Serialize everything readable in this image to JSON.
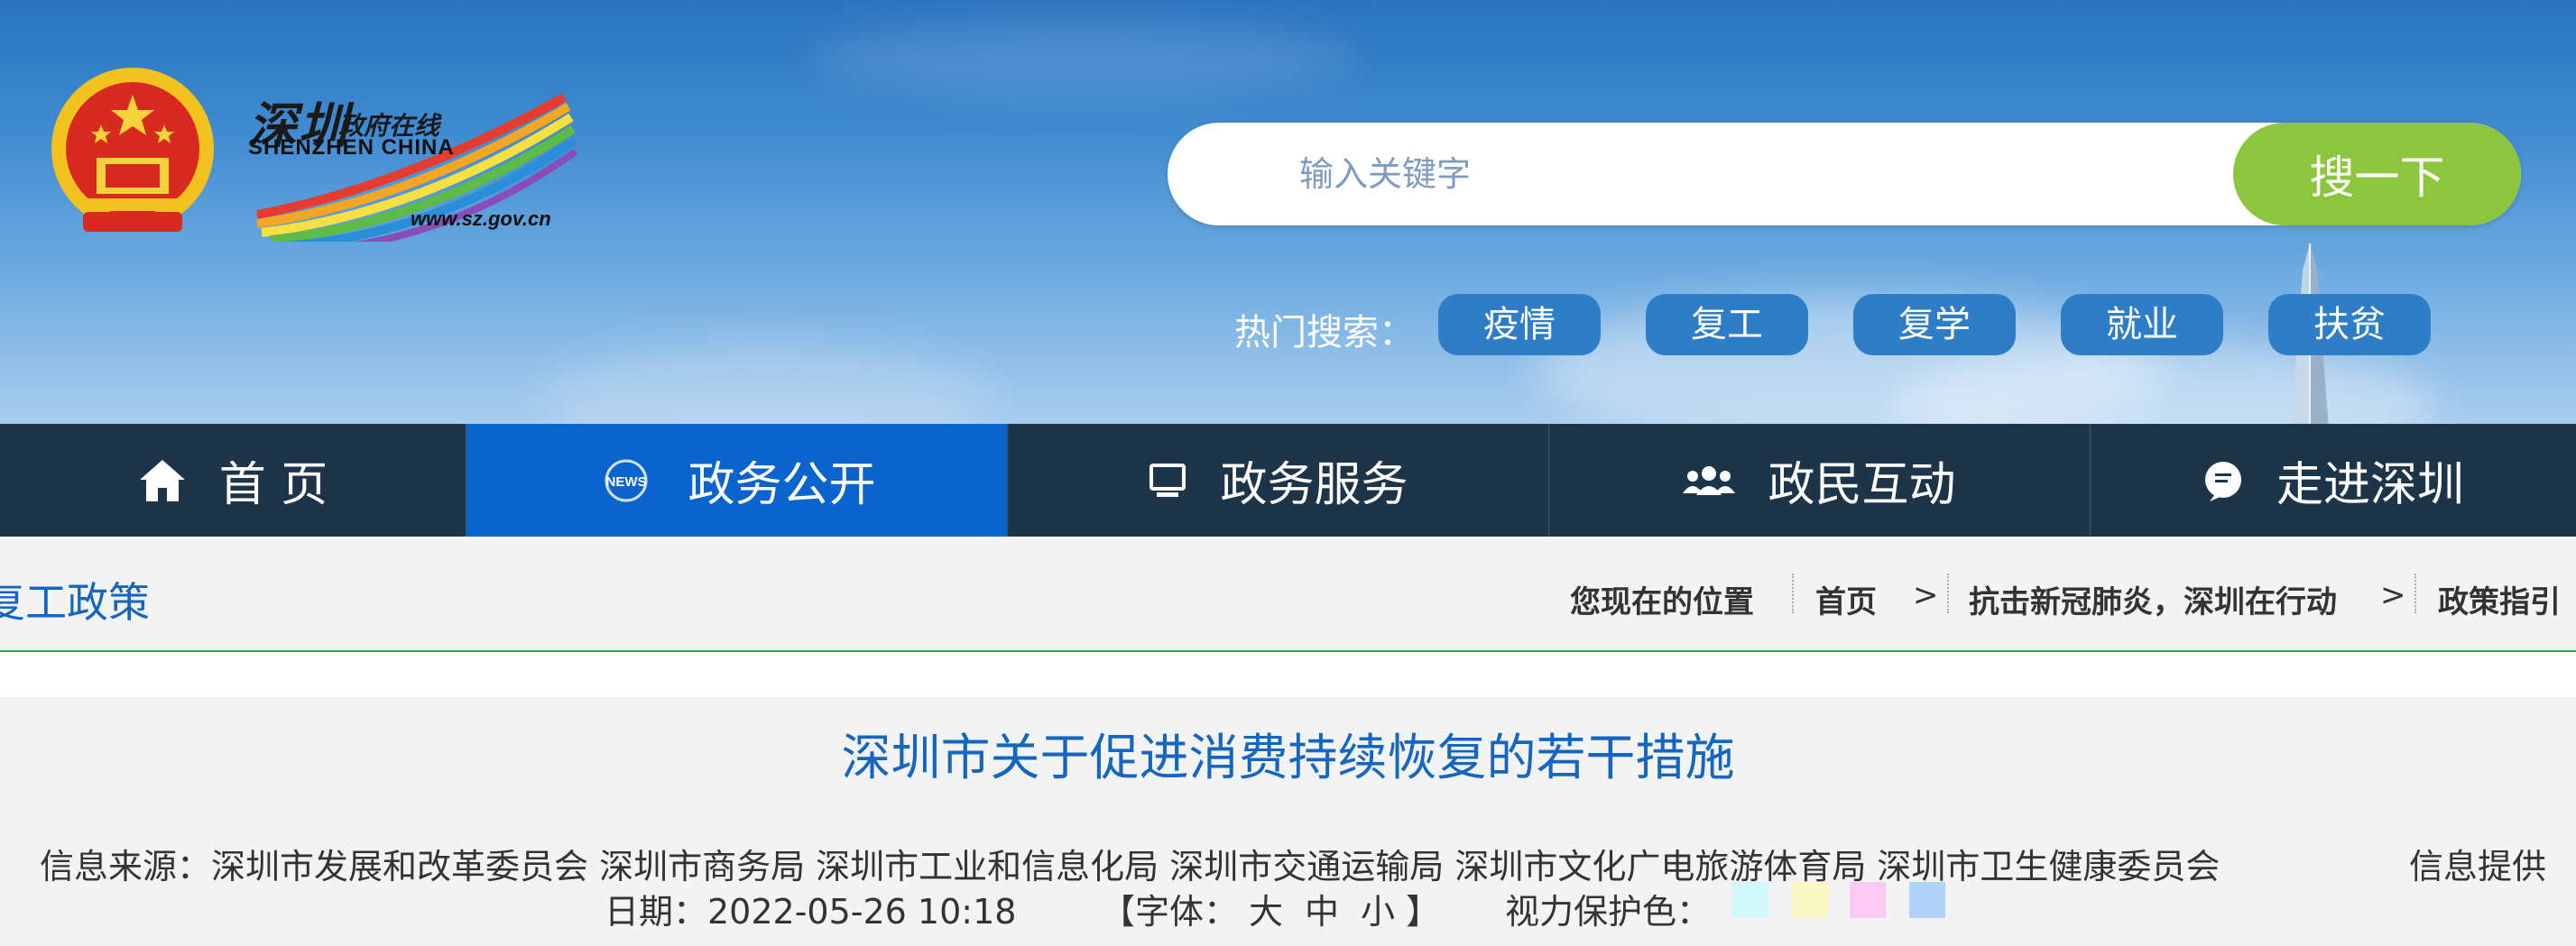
{
  "header": {
    "logo": {
      "cn": "深圳",
      "cn_small": "政府在线",
      "en": "SHENZHEN CHINA",
      "url": "www.sz.gov.cn"
    },
    "search": {
      "placeholder": "输入关键字",
      "button_label": "搜一下"
    },
    "hot_search": {
      "label": "热门搜索：",
      "tags": [
        "疫情",
        "复工",
        "复学",
        "就业",
        "扶贫"
      ]
    }
  },
  "nav": {
    "items": [
      {
        "label": "首 页",
        "icon": "home-icon"
      },
      {
        "label": "政务公开",
        "icon": "news-icon"
      },
      {
        "label": "政务服务",
        "icon": "monitor-icon"
      },
      {
        "label": "政民互动",
        "icon": "people-icon"
      },
      {
        "label": "走进深圳",
        "icon": "chat-icon"
      }
    ],
    "active_index": 1
  },
  "breadcrumb": {
    "section_title": "复工政策",
    "location_label": "您现在的位置",
    "items": [
      "首页",
      "抗击新冠肺炎，深圳在行动",
      "政策指引"
    ],
    "separator": ">"
  },
  "article": {
    "title": "深圳市关于促进消费持续恢复的若干措施",
    "source": "信息来源：深圳市发展和改革委员会 深圳市商务局 深圳市工业和信息化局 深圳市交通运输局 深圳市文化广电旅游体育局 深圳市卫生健康委员会",
    "provider": "信息提供",
    "date": "日期：2022-05-26 10:18",
    "font": {
      "open": "【字体：",
      "options": [
        "大",
        "中",
        "小"
      ],
      "close": "】"
    },
    "eye_protection_label": "视力保护色：",
    "eye_colors": [
      "#d3f8fb",
      "#fbf7c3",
      "#fbcaf2",
      "#b2d3f9"
    ]
  },
  "colors": {
    "accent": "#1466c0",
    "nav_bg": "#1e3448",
    "nav_active": "#0b63cd",
    "search_button": "#8cc63e"
  }
}
